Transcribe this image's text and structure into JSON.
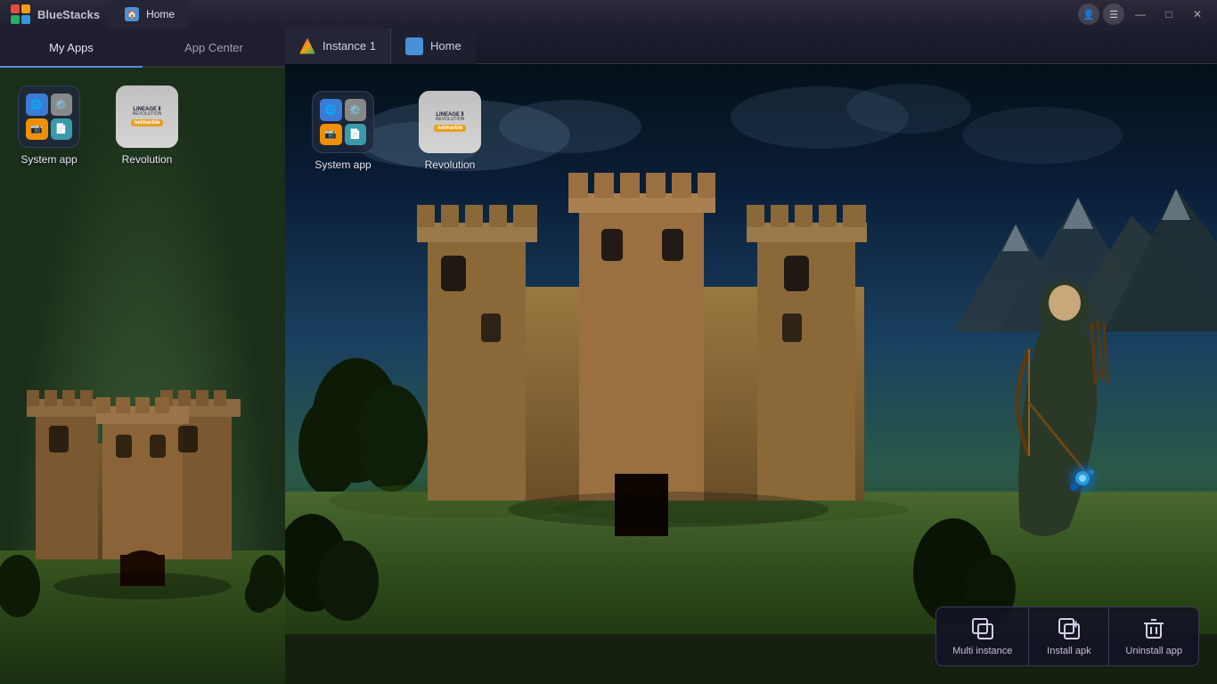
{
  "app": {
    "name": "BlueStacks",
    "logo_label": "BS"
  },
  "main_window": {
    "title_bar": {
      "tab_label": "Home",
      "minimize": "—",
      "maximize": "□",
      "close": "✕"
    }
  },
  "left_panel": {
    "tabs": [
      {
        "id": "my-apps",
        "label": "My Apps",
        "active": true
      },
      {
        "id": "app-center",
        "label": "App Center",
        "active": false
      }
    ],
    "apps": [
      {
        "id": "system-app",
        "label": "System app"
      },
      {
        "id": "revolution",
        "label": "Revolution"
      }
    ]
  },
  "instance_window": {
    "tab1": {
      "label": "Instance 1"
    },
    "tab2": {
      "label": "Home"
    },
    "apps": [
      {
        "id": "system-app",
        "label": "System app"
      },
      {
        "id": "revolution",
        "label": "Revolution"
      }
    ]
  },
  "toolbar": {
    "buttons": [
      {
        "id": "multi-instance",
        "label": "Multi instance",
        "icon": "⊞"
      },
      {
        "id": "install-apk",
        "label": "Install apk",
        "icon": "⊕"
      },
      {
        "id": "uninstall-app",
        "label": "Uninstall app",
        "icon": "🗑"
      }
    ]
  }
}
